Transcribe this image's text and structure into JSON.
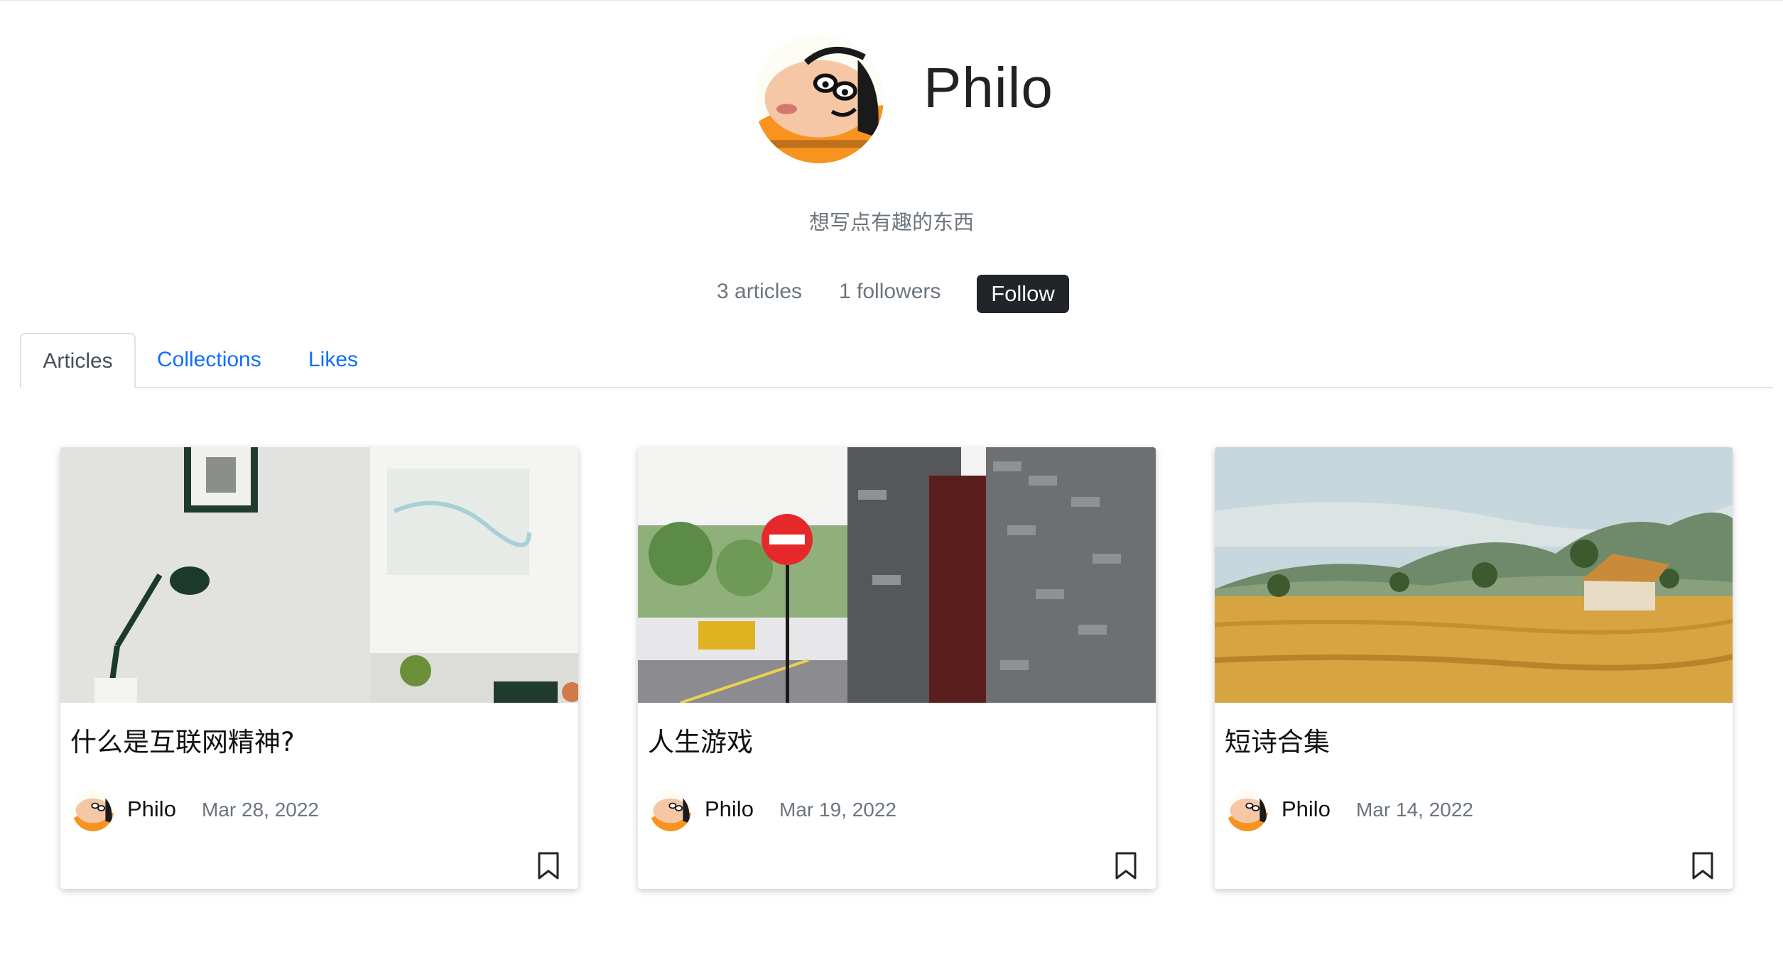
{
  "profile": {
    "name": "Philo",
    "avatar_icon": "crayon-shinchan-avatar",
    "bio": "想写点有趣的东西",
    "articles_count": "3 articles",
    "followers_count": "1 followers",
    "follow_label": "Follow"
  },
  "tabs": [
    {
      "label": "Articles",
      "active": true
    },
    {
      "label": "Collections",
      "active": false
    },
    {
      "label": "Likes",
      "active": false
    }
  ],
  "cards": [
    {
      "title": "什么是互联网精神?",
      "author": "Philo",
      "date": "Mar 28, 2022",
      "image": "desk-lamp-photo"
    },
    {
      "title": "人生游戏",
      "author": "Philo",
      "date": "Mar 19, 2022",
      "image": "street-brick-wall-photo"
    },
    {
      "title": "短诗合集",
      "author": "Philo",
      "date": "Mar 14, 2022",
      "image": "wheat-field-painting"
    }
  ],
  "colors": {
    "accent_link": "#0d6efd",
    "follow_button_bg": "#212529",
    "muted_text": "#6c757d"
  }
}
